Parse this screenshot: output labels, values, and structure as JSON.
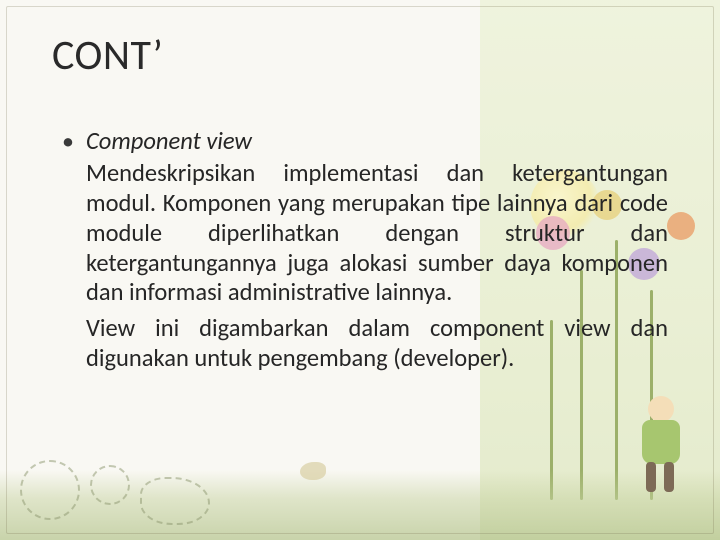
{
  "slide": {
    "title": "CONT’",
    "bullets": [
      {
        "heading": "Component view",
        "paragraphs": [
          "Mendeskripsikan implementasi dan ketergantungan modul. Komponen yang merupakan tipe lainnya dari code module diperlihatkan dengan struktur dan ketergantungannya juga alokasi sumber daya komponen dan informasi administrative lainnya.",
          "View ini digambarkan dalam component view dan digunakan untuk pengembang  (developer)."
        ]
      }
    ]
  }
}
